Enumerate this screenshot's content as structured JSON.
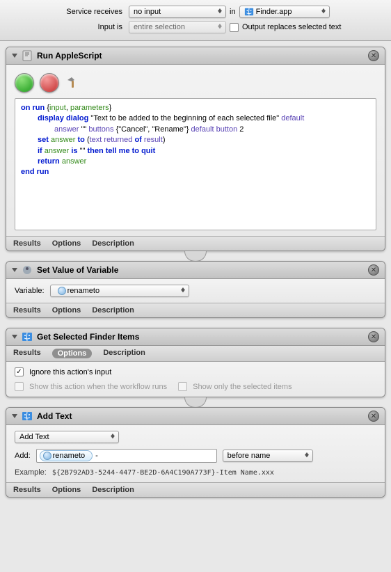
{
  "toolbar": {
    "service_receives_label": "Service receives",
    "service_receives_value": "no input",
    "in_label": "in",
    "app_value": "Finder.app",
    "input_is_label": "Input is",
    "input_is_value": "entire selection",
    "output_replaces_label": "Output replaces selected text"
  },
  "actions": {
    "applescript": {
      "title": "Run AppleScript",
      "footer": {
        "results": "Results",
        "options": "Options",
        "description": "Description"
      },
      "code": {
        "l1a": "on",
        "l1b": "run",
        "l1c": "{",
        "l1d": "input",
        "l1e": ",",
        "l1f": "parameters",
        "l1g": "}",
        "l2a": "display dialog",
        "l2b": "\"Text to be added to the beginning of each selected file\"",
        "l2c": "default",
        "l3a": "answer",
        "l3b": "\"\"",
        "l3c": "buttons",
        "l3d": "{\"Cancel\", \"Rename\"}",
        "l3e": "default button",
        "l3f": "2",
        "l4a": "set",
        "l4b": "answer",
        "l4c": "to",
        "l4d": "(",
        "l4e": "text returned",
        "l4f": "of",
        "l4g": "result",
        "l4h": ")",
        "l5a": "if",
        "l5b": "answer",
        "l5c": "is",
        "l5d": "\"\"",
        "l5e": "then tell me to",
        "l5f": "quit",
        "l6a": "return",
        "l6b": "answer",
        "l7a": "end",
        "l7b": "run"
      }
    },
    "setvar": {
      "title": "Set Value of Variable",
      "variable_label": "Variable:",
      "variable_value": "renameto",
      "footer": {
        "results": "Results",
        "options": "Options",
        "description": "Description"
      }
    },
    "getfinder": {
      "title": "Get Selected Finder Items",
      "footer": {
        "results": "Results",
        "options": "Options",
        "description": "Description"
      },
      "ignore_label": "Ignore this action's input",
      "show_runs_label": "Show this action when the workflow runs",
      "show_selected_label": "Show only the selected items"
    },
    "addtext": {
      "title": "Add Text",
      "select_value": "Add Text",
      "add_label": "Add:",
      "add_token": "renameto",
      "add_suffix": "-",
      "position_value": "before name",
      "example_label": "Example:",
      "example_value": "${2B792AD3-5244-4477-BE2D-6A4C190A773F}-Item Name.xxx",
      "footer": {
        "results": "Results",
        "options": "Options",
        "description": "Description"
      }
    }
  }
}
